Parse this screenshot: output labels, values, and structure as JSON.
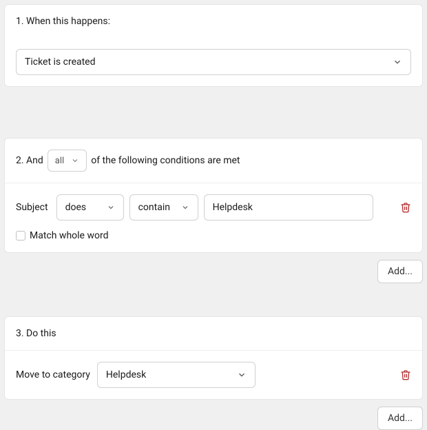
{
  "trigger": {
    "heading": "1. When this happens:",
    "event": "Ticket is created"
  },
  "conditions": {
    "heading_prefix": "2. And",
    "match_mode": "all",
    "heading_suffix": "of the following conditions are met",
    "rows": [
      {
        "field": "Subject",
        "does": "does",
        "operator": "contain",
        "value": "Helpdesk",
        "whole_word_label": "Match whole word",
        "whole_word_checked": false
      }
    ],
    "add_label": "Add..."
  },
  "actions": {
    "heading": "3. Do this",
    "rows": [
      {
        "label": "Move to category",
        "value": "Helpdesk"
      }
    ],
    "add_label": "Add..."
  }
}
